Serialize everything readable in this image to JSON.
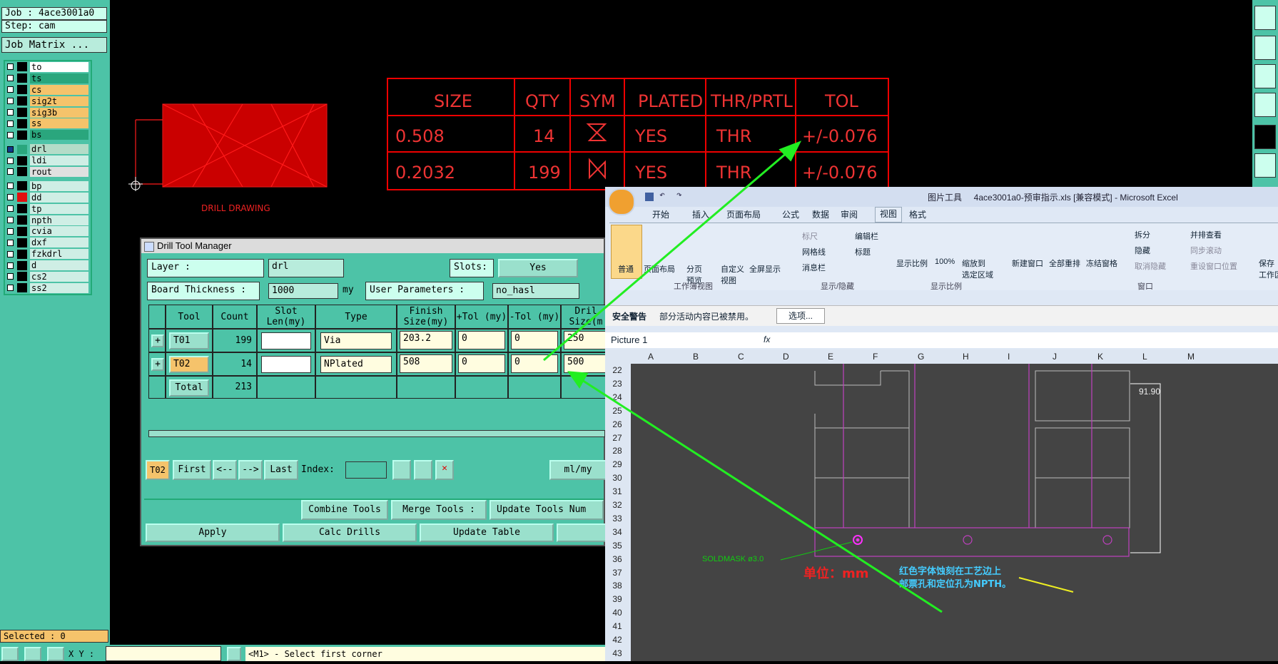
{
  "left_panel": {
    "job": "Job : 4ace3001a0",
    "step": "Step: cam",
    "job_matrix": "Job Matrix ...",
    "layers": [
      {
        "name": "to",
        "color": "#ffffff",
        "swatch": "#000000",
        "checked": false
      },
      {
        "name": "ts",
        "color": "#2aa67d",
        "swatch": "#000000",
        "checked": false
      },
      {
        "name": "cs",
        "color": "#f5c36b",
        "swatch": "#000000",
        "checked": false
      },
      {
        "name": "sig2t",
        "color": "#f5c36b",
        "swatch": "#000000",
        "checked": false
      },
      {
        "name": "sig3b",
        "color": "#f5c36b",
        "swatch": "#000000",
        "checked": false
      },
      {
        "name": "ss",
        "color": "#f5c36b",
        "swatch": "#000000",
        "checked": false
      },
      {
        "name": "bs",
        "color": "#2aa67d",
        "swatch": "#000000",
        "checked": false
      },
      {
        "name": "drl",
        "color": "#b4dcc8",
        "swatch": "#2aa67d",
        "checked": true
      },
      {
        "name": "ldi",
        "color": "#cfeee5",
        "swatch": "#000000",
        "checked": false
      },
      {
        "name": "rout",
        "color": "#e0e0e0",
        "swatch": "#000000",
        "checked": false
      },
      {
        "name": "bp",
        "color": "#cfeee5",
        "swatch": "#000000",
        "checked": false
      },
      {
        "name": "dd",
        "color": "#cfeee5",
        "swatch": "#e01010",
        "checked": false
      },
      {
        "name": "tp",
        "color": "#cfeee5",
        "swatch": "#000000",
        "checked": false
      },
      {
        "name": "npth",
        "color": "#cfeee5",
        "swatch": "#000000",
        "checked": false
      },
      {
        "name": "cvia",
        "color": "#cfeee5",
        "swatch": "#000000",
        "checked": false
      },
      {
        "name": "dxf",
        "color": "#cfeee5",
        "swatch": "#000000",
        "checked": false
      },
      {
        "name": "fzkdrl",
        "color": "#cfeee5",
        "swatch": "#000000",
        "checked": false
      },
      {
        "name": "d",
        "color": "#cfeee5",
        "swatch": "#000000",
        "checked": false
      },
      {
        "name": "cs2",
        "color": "#cfeee5",
        "swatch": "#000000",
        "checked": false
      },
      {
        "name": "ss2",
        "color": "#cfeee5",
        "swatch": "#000000",
        "checked": false
      }
    ],
    "selected": "Selected : 0"
  },
  "canvas": {
    "drill_drawing_label": "DRILL DRAWING",
    "table": {
      "headers": [
        "SIZE",
        "QTY",
        "SYM",
        "PLATED",
        "THR/PRTL",
        "TOL"
      ],
      "rows": [
        [
          "0.508",
          "14",
          "hourglass",
          "YES",
          "THR",
          "+/-0.076"
        ],
        [
          "0.2032",
          "199",
          "bowtie",
          "YES",
          "THR",
          "+/-0.076"
        ]
      ]
    }
  },
  "drill_tool_manager": {
    "title": "Drill Tool Manager",
    "layer_label": "Layer           :",
    "layer_value": "drl",
    "slots_label": "Slots:",
    "slots_value": "Yes",
    "board_thickness_label": "Board Thickness :",
    "board_thickness_value": "1000",
    "board_thickness_unit": "my",
    "user_params_label": "User Parameters :",
    "user_params_value": "no_hasl",
    "columns": [
      "Tool",
      "Count",
      "Slot Len(my)",
      "Type",
      "Finish Size(my)",
      "+Tol (my)",
      "-Tol (my)",
      "Dril Size(m"
    ],
    "rows": [
      {
        "tool": "T01",
        "count": "199",
        "slot": "",
        "type": "Via",
        "finish": "203.2",
        "ptol": "0",
        "ntol": "0",
        "drill": "250",
        "highlight": false
      },
      {
        "tool": "T02",
        "count": "14",
        "slot": "",
        "type": "NPlated",
        "finish": "508",
        "ptol": "0",
        "ntol": "0",
        "drill": "500",
        "highlight": true
      }
    ],
    "total_label": "Total",
    "total_count": "213",
    "current_tool": "T02",
    "nav": {
      "first": "First",
      "prev": "<--",
      "next": "-->",
      "last": "Last",
      "index_label": "Index:"
    },
    "units_value": "ml/my",
    "combine": "Combine Tools",
    "merge": "Merge Tools :",
    "update_nums": "Update Tools Num",
    "apply": "Apply",
    "calc": "Calc Drills",
    "update_table": "Update Table"
  },
  "bottom": {
    "xy_label": "X Y :",
    "status": "<M1> - Select first corner"
  },
  "excel": {
    "title": "图片工具     4ace3001a0-预审指示.xls [兼容模式] - Microsoft Excel",
    "tabs": [
      "开始",
      "插入",
      "页面布局",
      "公式",
      "数据",
      "审阅",
      "视图",
      "格式"
    ],
    "ribbon": {
      "normal": "普通",
      "page_layout": "页面布局",
      "page_break": "分页\n预览",
      "custom_view": "自定义\n视图",
      "fullscreen": "全屏显示",
      "group1": "工作簿视图",
      "ruler": "标尺",
      "formula_bar": "编辑栏",
      "gridlines": "网格线",
      "headings": "标题",
      "message_bar": "消息栏",
      "group2": "显示/隐藏",
      "zoom": "显示比例",
      "zoom100": "100%",
      "zoom_sel": "缩放到\n选定区域",
      "group3": "显示比例",
      "new_window": "新建窗口",
      "arrange_all": "全部重排",
      "freeze": "冻结窗格",
      "split": "拆分",
      "hide": "隐藏",
      "unhide": "取消隐藏",
      "side_by_side": "并排查看",
      "sync_scroll": "同步滚动",
      "reset_pos": "重设窗口位置",
      "save_ws": "保存\n工作区",
      "group4": "窗口"
    },
    "security_label": "安全警告",
    "security_text": "部分活动内容已被禁用。",
    "options_button": "选项...",
    "name_box": "Picture 1",
    "fx": "fx",
    "columns": [
      "A",
      "B",
      "C",
      "D",
      "E",
      "F",
      "G",
      "H",
      "I",
      "J",
      "K",
      "L",
      "M"
    ],
    "rows": [
      "22",
      "23",
      "24",
      "25",
      "26",
      "27",
      "28",
      "29",
      "30",
      "31",
      "32",
      "33",
      "34",
      "35",
      "36",
      "37",
      "38",
      "39",
      "40",
      "41",
      "42",
      "43"
    ],
    "dimension_label": "91.90",
    "soldmask_label": "SOLDMASK  ø3.0",
    "unit_label": "单位：mm",
    "note_line1": "红色字体蚀刻在工艺边上",
    "note_line2": "邮票孔和定位孔为NPTH。"
  }
}
